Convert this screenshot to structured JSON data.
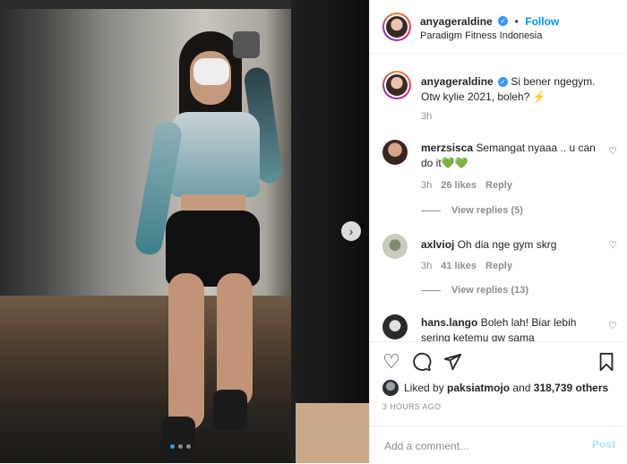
{
  "post": {
    "author": "anyageraldine",
    "follow_label": "Follow",
    "separator": "•",
    "location": "Paradigm Fitness Indonesia",
    "more_icon": "ellipsis-icon",
    "caption": {
      "username": "anyageraldine",
      "text": "Si bener ngegym. Otw kylie 2021, boleh? ⚡",
      "time": "3h"
    },
    "comments": [
      {
        "username": "merzsisca",
        "text": "Semangat nyaaa .. u can do it💚💚",
        "time": "3h",
        "likes": "26 likes",
        "reply": "Reply",
        "view_replies": "View replies (5)"
      },
      {
        "username": "axlvioj",
        "text": "Oh dia nge gym skrg",
        "time": "3h",
        "likes": "41 likes",
        "reply": "Reply",
        "view_replies": "View replies (13)"
      },
      {
        "username": "hans.lango",
        "text": "Boleh lah! Biar lebih sering ketemu gw sama"
      }
    ],
    "liked_by": {
      "prefix": "Liked by",
      "user": "paksiatmojo",
      "middle": "and",
      "others": "318,739 others"
    },
    "timestamp": "3 HOURS AGO",
    "add_comment_placeholder": "Add a comment...",
    "post_label": "Post"
  },
  "carousel": {
    "slide_count": 3,
    "active_index": 0
  },
  "colors": {
    "accent": "#0095f6",
    "verified": "#3897f0",
    "muted": "#8e8e8e",
    "post_disabled": "#b2dffc",
    "heart_green": "#2ecc40"
  }
}
